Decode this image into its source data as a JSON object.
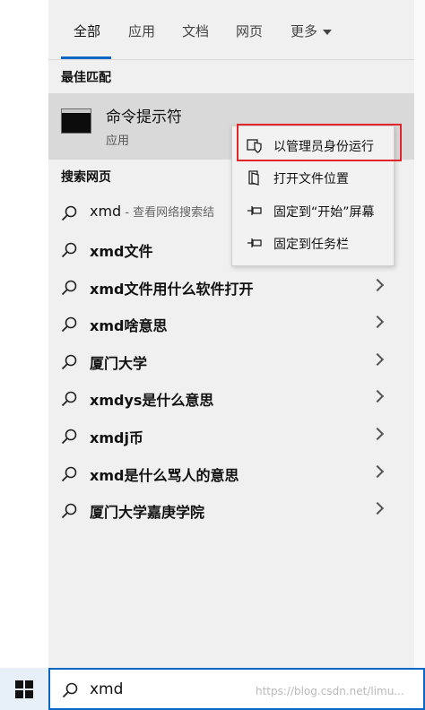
{
  "tabs": [
    {
      "label": "全部",
      "active": true
    },
    {
      "label": "应用"
    },
    {
      "label": "文档"
    },
    {
      "label": "网页"
    },
    {
      "label": "更多"
    }
  ],
  "best_match": {
    "heading": "最佳匹配",
    "name": "命令提示符",
    "type": "应用",
    "icon": "command-prompt-icon"
  },
  "web": {
    "heading": "搜索网页",
    "items": [
      {
        "label": "xmd",
        "sub": " - 查看网络搜索结"
      },
      {
        "label": "xmd文件"
      },
      {
        "label": "xmd文件用什么软件打开"
      },
      {
        "label": "xmd啥意思"
      },
      {
        "label": "厦门大学"
      },
      {
        "label": "xmdys是什么意思"
      },
      {
        "label": "xmdj币"
      },
      {
        "label": "xmd是什么骂人的意思"
      },
      {
        "label": "厦门大学嘉庚学院"
      }
    ]
  },
  "context_menu": {
    "items": [
      {
        "label": "以管理员身份运行",
        "icon": "shield-icon"
      },
      {
        "label": "打开文件位置",
        "icon": "file-location-icon"
      },
      {
        "label": "固定到“开始”屏幕",
        "icon": "pin-icon"
      },
      {
        "label": "固定到任务栏",
        "icon": "pin-icon"
      }
    ],
    "highlight_color": "#e0262a"
  },
  "taskbar": {
    "search_value": "xmd",
    "watermark": "https://blog.csdn.net/limu..."
  },
  "colors": {
    "accent": "#0a67c6",
    "panel": "#f0f0f0",
    "selected": "#d9d9d9"
  }
}
